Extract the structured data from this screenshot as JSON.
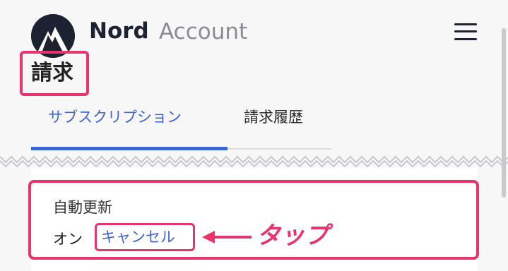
{
  "header": {
    "brand_primary": "Nord",
    "brand_secondary": "Account",
    "logo_icon": "nord-mountain-logo",
    "menu_icon": "hamburger-menu-icon"
  },
  "page": {
    "title": "請求"
  },
  "tabs": [
    {
      "label": "サブスクリプション",
      "active": true
    },
    {
      "label": "請求履歴",
      "active": false
    }
  ],
  "auto_renew": {
    "label": "自動更新",
    "status": "オン",
    "cancel_label": "キャンセル"
  },
  "annotation": {
    "tap_label": "タップ"
  },
  "colors": {
    "accent_blue": "#3d63d8",
    "highlight_pink": "#e8336d",
    "brand_dark": "#1d2233"
  }
}
